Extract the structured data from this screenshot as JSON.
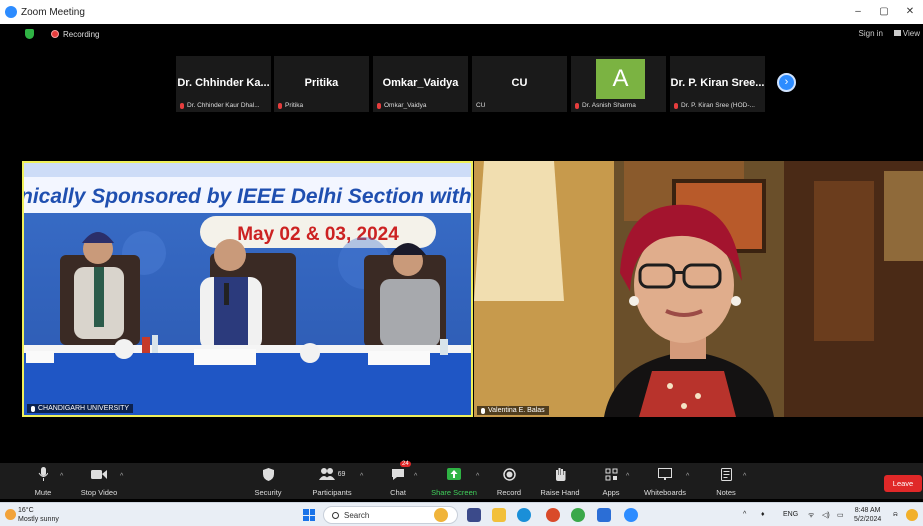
{
  "window": {
    "title": "Zoom Meeting",
    "controls": [
      "–",
      "▢",
      "✕"
    ]
  },
  "topbar": {
    "recording": "Recording",
    "sign_in": "Sign in",
    "view": "View"
  },
  "gallery": [
    {
      "name": "Dr. Chhinder Ka...",
      "sub": "Dr. Chhinder Kaur Dhal...",
      "muted": true
    },
    {
      "name": "Pritika",
      "sub": "Pritika",
      "muted": true
    },
    {
      "name": "Omkar_Vaidya",
      "sub": "Omkar_Vaidya",
      "muted": true
    },
    {
      "name": "CU",
      "sub": "CU",
      "muted": false
    },
    {
      "name": "",
      "avatar": "A",
      "sub": "Dr. Asnish Sharma",
      "muted": true
    },
    {
      "name": "Dr. P. Kiran Sree...",
      "sub": "Dr. P. Kiran Sree (HOD-...",
      "muted": true
    }
  ],
  "video_left": {
    "label": "CHANDIGARH UNIVERSITY",
    "banner_line": "nically Sponsored by IEEE Delhi Section with",
    "banner_date": "May 02 & 03, 2024"
  },
  "video_right": {
    "label": "Valentina E. Balas"
  },
  "toolbar": {
    "mute": "Mute",
    "stop_video": "Stop Video",
    "security": "Security",
    "participants": "Participants",
    "participants_count": "69",
    "chat": "Chat",
    "chat_badge": "24",
    "share_screen": "Share Screen",
    "record": "Record",
    "raise_hand": "Raise Hand",
    "apps": "Apps",
    "whiteboards": "Whiteboards",
    "notes": "Notes",
    "leave": "Leave"
  },
  "taskbar": {
    "temp": "16°C",
    "weather": "Mostly sunny",
    "search_placeholder": "Search",
    "lang": "ENG",
    "time": "8:48 AM",
    "date": "5/2/2024"
  },
  "colors": {
    "accent": "#2d8cff",
    "leave": "#e02828",
    "share": "#2fb344",
    "active_speaker": "#f0f05a"
  }
}
